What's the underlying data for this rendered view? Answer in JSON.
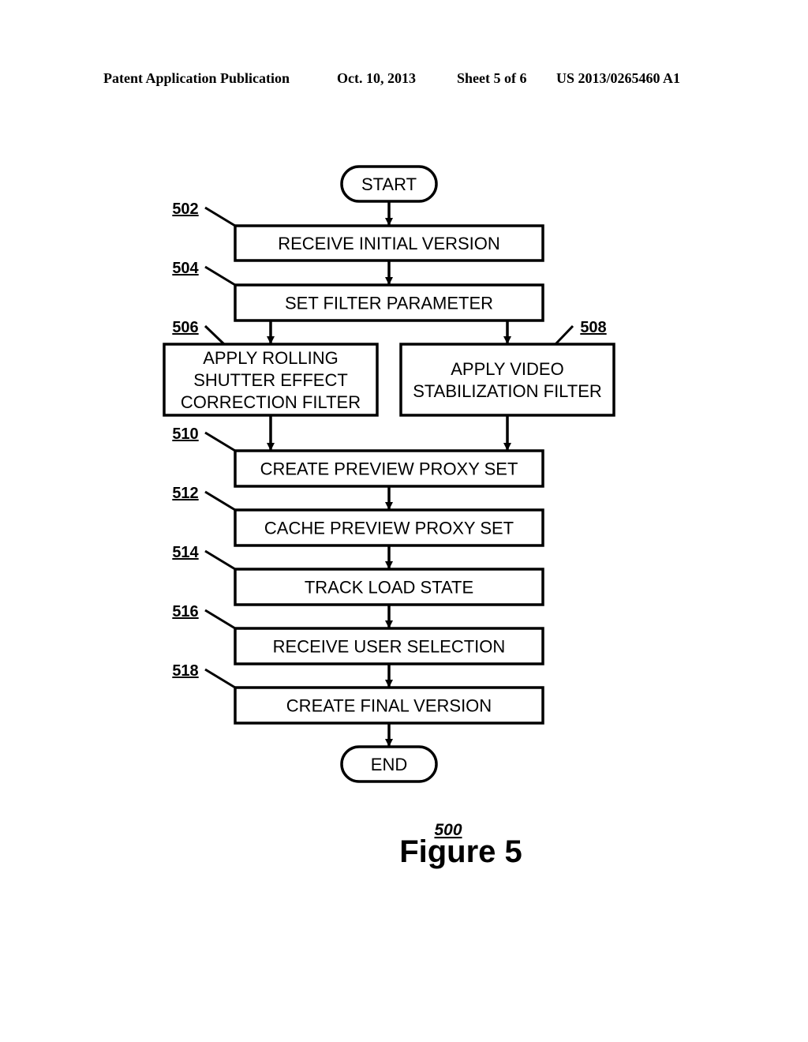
{
  "header": {
    "publication": "Patent Application Publication",
    "date": "Oct. 10, 2013",
    "sheet": "Sheet 5 of 6",
    "number": "US 2013/0265460 A1"
  },
  "flowchart": {
    "start": "START",
    "end": "END",
    "steps": [
      {
        "ref": "502",
        "lines": [
          "RECEIVE INITIAL VERSION"
        ]
      },
      {
        "ref": "504",
        "lines": [
          "SET FILTER PARAMETER"
        ]
      },
      {
        "ref": "506",
        "lines": [
          "APPLY ROLLING",
          "SHUTTER EFFECT",
          "CORRECTION FILTER"
        ]
      },
      {
        "ref": "508",
        "lines": [
          "APPLY VIDEO",
          "STABILIZATION FILTER"
        ]
      },
      {
        "ref": "510",
        "lines": [
          "CREATE PREVIEW PROXY SET"
        ]
      },
      {
        "ref": "512",
        "lines": [
          "CACHE PREVIEW PROXY SET"
        ]
      },
      {
        "ref": "514",
        "lines": [
          "TRACK LOAD STATE"
        ]
      },
      {
        "ref": "516",
        "lines": [
          "RECEIVE USER SELECTION"
        ]
      },
      {
        "ref": "518",
        "lines": [
          "CREATE FINAL VERSION"
        ]
      }
    ]
  },
  "figure": {
    "ref": "500",
    "title": "Figure 5"
  }
}
